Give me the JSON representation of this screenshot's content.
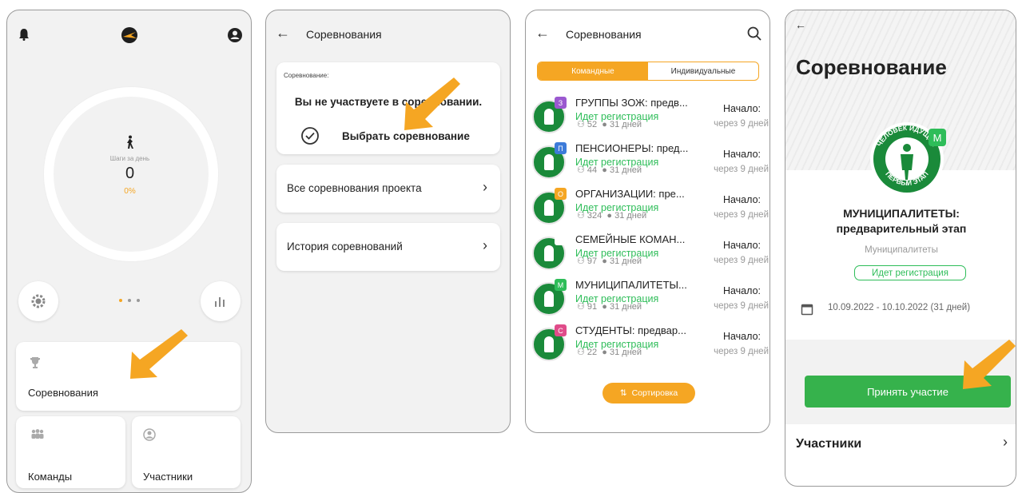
{
  "colors": {
    "accent": "#f5a623",
    "green": "#2ebd59",
    "button_green": "#36b24c"
  },
  "panel1": {
    "steps_label": "Шаги за день",
    "steps_value": "0",
    "steps_percent": "0%",
    "competitions_label": "Соревнования",
    "teams_label": "Команды",
    "participants_label": "Участники"
  },
  "panel2": {
    "title": "Соревнования",
    "current_caption": "Соревнование:",
    "not_participating": "Вы не участвуете в соревновании.",
    "choose_label": "Выбрать соревнование",
    "all_label": "Все соревнования проекта",
    "history_label": "История соревнований"
  },
  "panel3": {
    "title": "Соревнования",
    "tab_team": "Командные",
    "tab_individual": "Индивидуальные",
    "sort_label": "Сортировка",
    "rows": [
      {
        "badge": "З",
        "badge_color": "#9b59d0",
        "title": "ГРУППЫ ЗОЖ: предв...",
        "status": "Идет регистрация",
        "members": "52",
        "days": "31 дней",
        "start": "Начало:",
        "when": "через 9 дней"
      },
      {
        "badge": "П",
        "badge_color": "#3d7bd9",
        "title": "ПЕНСИОНЕРЫ: пред...",
        "status": "Идет регистрация",
        "members": "44",
        "days": "31 дней",
        "start": "Начало:",
        "when": "через 9 дней"
      },
      {
        "badge": "О",
        "badge_color": "#f5a623",
        "title": "ОРГАНИЗАЦИИ: пре...",
        "status": "Идет регистрация",
        "members": "324",
        "days": "31 дней",
        "start": "Начало:",
        "when": "через 9 дней"
      },
      {
        "badge": "",
        "badge_color": "#ffffff",
        "title": "СЕМЕЙНЫЕ КОМАН...",
        "status": "Идет регистрация",
        "members": "97",
        "days": "31 дней",
        "start": "Начало:",
        "when": "через 9 дней"
      },
      {
        "badge": "М",
        "badge_color": "#2ebd59",
        "title": "МУНИЦИПАЛИТЕТЫ...",
        "status": "Идет регистрация",
        "members": "91",
        "days": "31 дней",
        "start": "Начало:",
        "when": "через 9 дней"
      },
      {
        "badge": "С",
        "badge_color": "#e04c8a",
        "title": "СТУДЕНТЫ: предвар...",
        "status": "Идет регистрация",
        "members": "22",
        "days": "31 дней",
        "start": "Начало:",
        "when": "через 9 дней"
      }
    ]
  },
  "panel4": {
    "title": "Соревнование",
    "logo_badge": "М",
    "logo_text_top": "ЧЕЛОВЕК ИДУЩИЙ",
    "logo_text_bottom": "ПЕРВЫЙ ЭТАП",
    "name_line1": "МУНИЦИПАЛИТЕТЫ:",
    "name_line2": "предварительный этап",
    "category": "Муниципалитеты",
    "status": "Идет регистрация",
    "dates": "10.09.2022 - 10.10.2022 (31 дней)",
    "join_label": "Принять участие",
    "participants_label": "Участники"
  }
}
